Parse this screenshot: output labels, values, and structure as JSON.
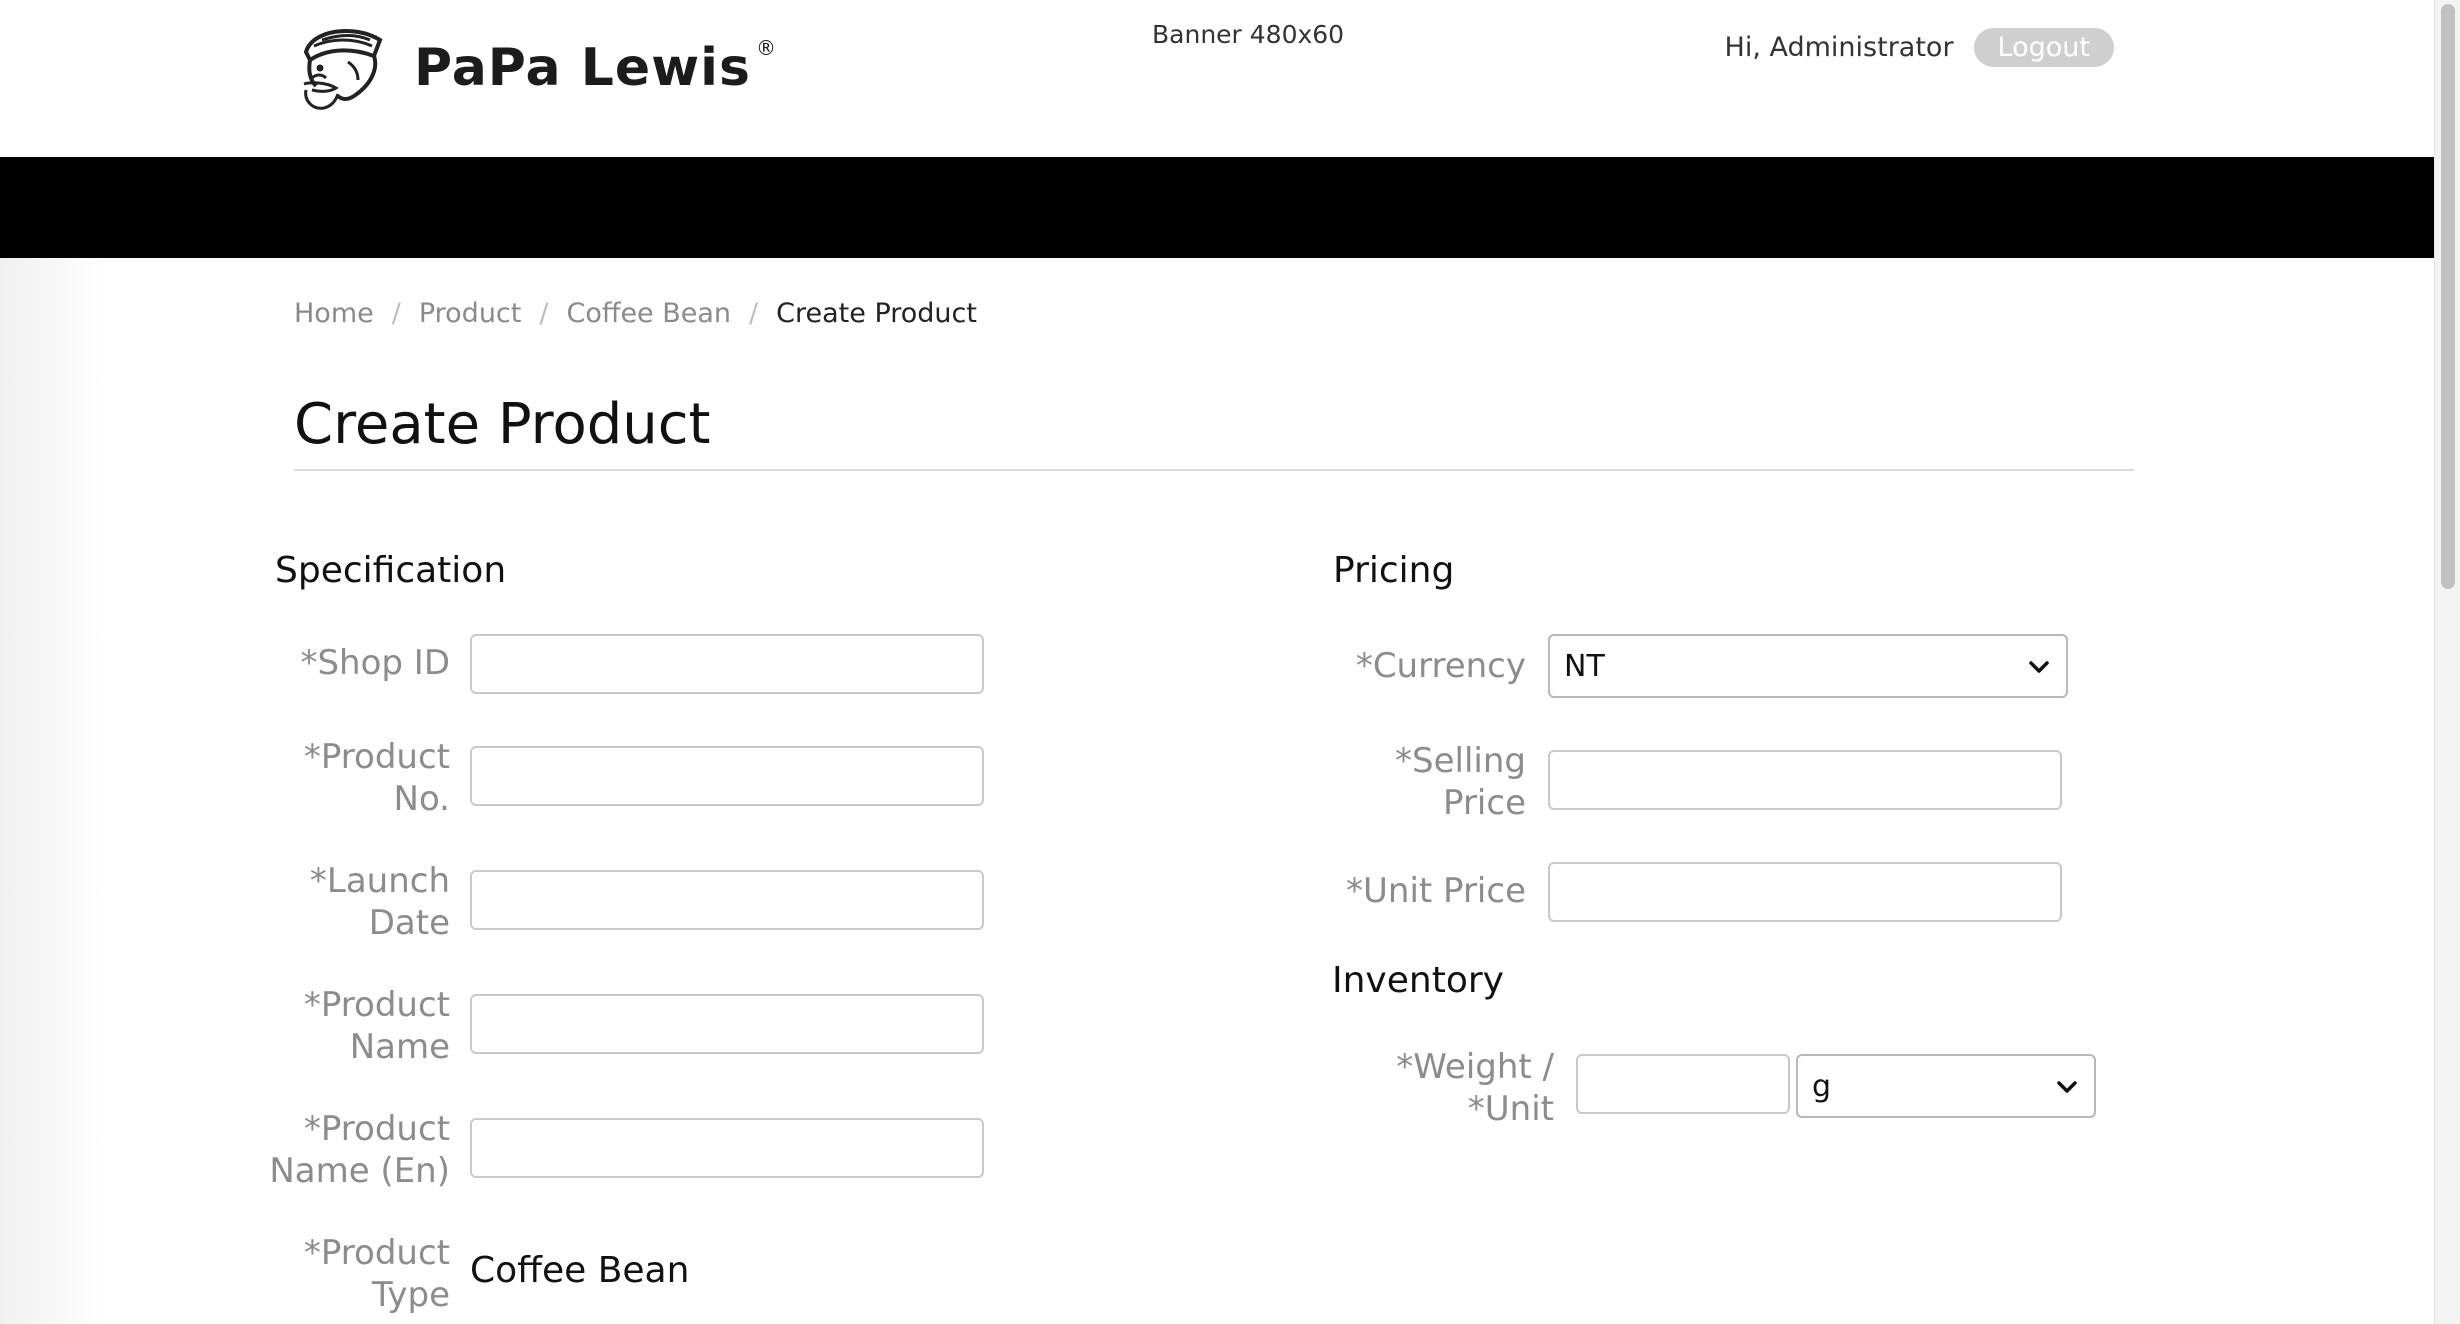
{
  "header": {
    "brand": "PaPa Lewis",
    "brand_mark": "®",
    "banner": "Banner 480x60",
    "greeting": "Hi, Administrator",
    "logout_label": "Logout"
  },
  "breadcrumb": {
    "items": [
      "Home",
      "Product",
      "Coffee Bean"
    ],
    "separator": "/",
    "current": "Create Product"
  },
  "page_title": "Create Product",
  "specification": {
    "title": "Specification",
    "shop_id_label": "*Shop ID",
    "product_no_label": [
      "*Product",
      "No."
    ],
    "launch_date_label": [
      "*Launch",
      "Date"
    ],
    "product_name_label": [
      "*Product",
      "Name"
    ],
    "product_name_en_label": [
      "*Product",
      "Name (En)"
    ],
    "product_type_label": [
      "*Product",
      "Type"
    ],
    "product_type_value": "Coffee Bean"
  },
  "pricing": {
    "title": "Pricing",
    "currency_label": "*Currency",
    "currency_value": "NT",
    "selling_price_label": [
      "*Selling",
      "Price"
    ],
    "unit_price_label": "*Unit Price"
  },
  "inventory": {
    "title": "Inventory",
    "weight_unit_label": [
      "*Weight /",
      "*Unit"
    ],
    "unit_value": "g"
  },
  "icons": {
    "logo": "captain-face-logo-icon",
    "select_arrow": "chevron-down-icon"
  }
}
